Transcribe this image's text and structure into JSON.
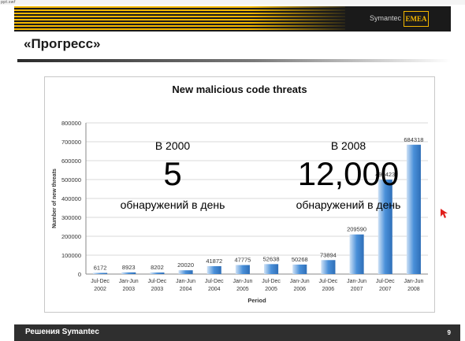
{
  "window": {
    "filename": "ppt.swf"
  },
  "header": {
    "brand": "Symantec",
    "region": "EMEA"
  },
  "slide": {
    "title": "«Прогресс»",
    "left_stat": {
      "label": "В 2000",
      "value": "5",
      "caption": "обнаружений в день"
    },
    "right_stat": {
      "label": "В 2008",
      "value": "12,000",
      "caption": "обнаружений в день"
    }
  },
  "footer": {
    "label": "Решения Symantec",
    "page": "9"
  },
  "colors": {
    "accent": "#f2b600",
    "bar": "#4a90d9",
    "bar_light": "#cfe2f6"
  },
  "chart_data": {
    "type": "bar",
    "title": "New malicious code threats",
    "xlabel": "Period",
    "ylabel": "Number of new threats",
    "ylim": [
      0,
      800000
    ],
    "yticks": [
      "0",
      "100000",
      "200000",
      "300000",
      "400000",
      "500000",
      "600000",
      "700000",
      "800000"
    ],
    "categories": [
      [
        "Jul-Dec",
        "2002"
      ],
      [
        "Jan-Jun",
        "2003"
      ],
      [
        "Jul-Dec",
        "2003"
      ],
      [
        "Jan-Jun",
        "2004"
      ],
      [
        "Jul-Dec",
        "2004"
      ],
      [
        "Jan-Jun",
        "2005"
      ],
      [
        "Jul-Dec",
        "2005"
      ],
      [
        "Jan-Jun",
        "2006"
      ],
      [
        "Jul-Dec",
        "2006"
      ],
      [
        "Jan-Jun",
        "2007"
      ],
      [
        "Jul-Dec",
        "2007"
      ],
      [
        "Jan-Jun",
        "2008"
      ]
    ],
    "values": [
      6172,
      8923,
      8202,
      20020,
      41872,
      47775,
      52638,
      50268,
      73894,
      209590,
      499423,
      684318
    ],
    "labels": [
      "6172",
      "8923",
      "8202",
      "20020",
      "41872",
      "47775",
      "52638",
      "50268",
      "73894",
      "209590",
      "499423",
      "684318"
    ],
    "grid": true,
    "legend": "none"
  }
}
